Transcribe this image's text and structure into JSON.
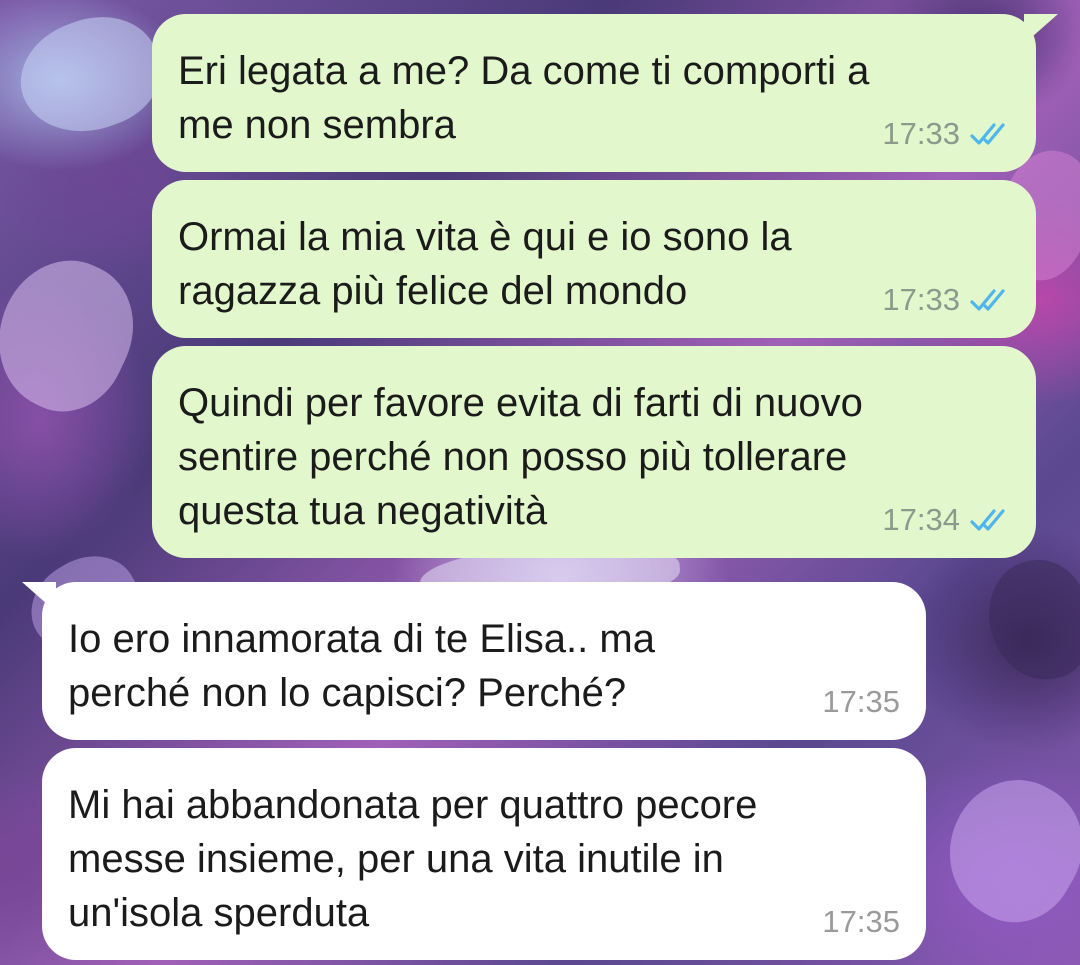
{
  "chat": {
    "messages": [
      {
        "direction": "outgoing",
        "text": "Eri legata a me? Da come ti comporti a\nme non sembra",
        "time": "17:33",
        "status": "read"
      },
      {
        "direction": "outgoing",
        "text": "Ormai la mia vita è qui  e io sono la\nragazza più felice del mondo",
        "time": "17:33",
        "status": "read"
      },
      {
        "direction": "outgoing",
        "text": "Quindi per favore evita di farti di nuovo\nsentire perché non posso più tollerare\nquesta tua negatività",
        "time": "17:34",
        "status": "read"
      },
      {
        "direction": "incoming",
        "text": "Io ero innamorata di te Elisa.. ma\nperché non lo capisci? Perché?",
        "time": "17:35"
      },
      {
        "direction": "incoming",
        "text": "Mi hai abbandonata per quattro pecore\nmesse insieme, per una vita inutile in\nun'isola sperduta",
        "time": "17:35"
      }
    ]
  },
  "colors": {
    "outgoing_bubble": "#e2f8cc",
    "incoming_bubble": "#ffffff",
    "read_tick": "#4fb6ec"
  },
  "icons": {
    "read_status": "double-check-icon"
  }
}
